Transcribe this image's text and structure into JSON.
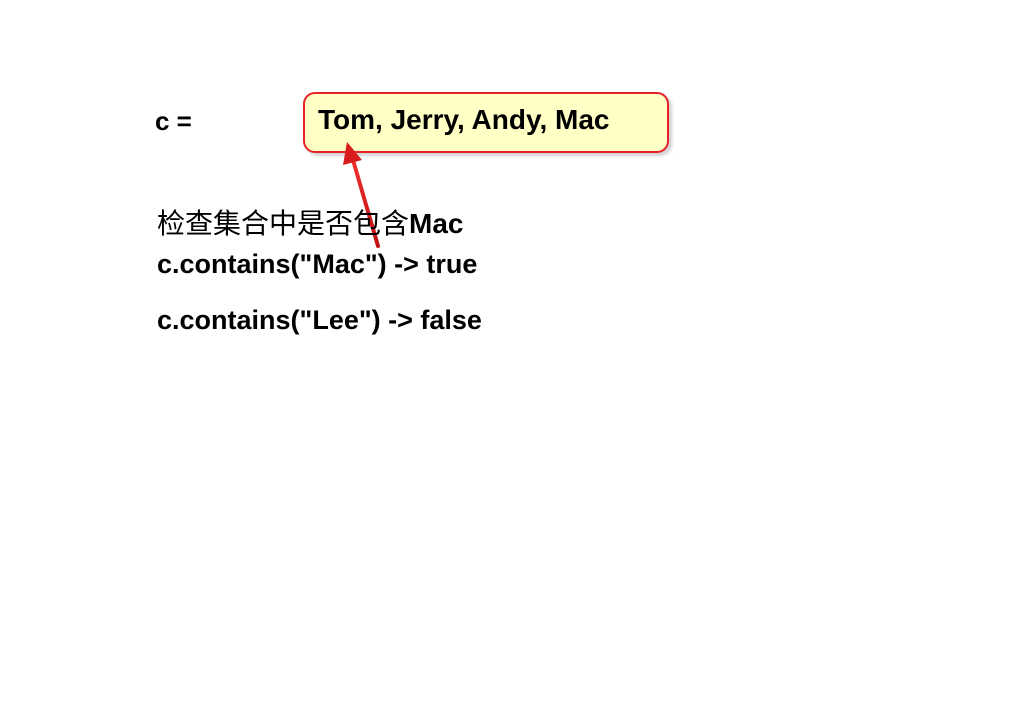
{
  "colors": {
    "box_fill": "#ffffc6",
    "box_border": "#e8202a",
    "arrow": "#d81b1b",
    "text": "#000000"
  },
  "variable_label": "c =",
  "collection": {
    "items_text": "Tom, Jerry, Andy, Mac"
  },
  "caption": {
    "cjk": "检查集合中是否包含",
    "ascii": "Mac"
  },
  "code_lines": [
    "c.contains(\"Mac\") -> true",
    "c.contains(\"Lee\") -> false"
  ]
}
